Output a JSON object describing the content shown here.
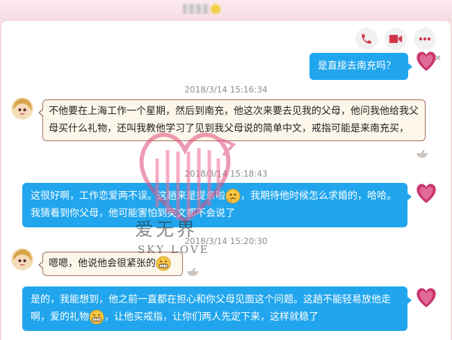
{
  "header": {
    "contact_name_blurred": true
  },
  "actions": [
    {
      "name": "phone-call",
      "icon": "phone-icon"
    },
    {
      "name": "video-call",
      "icon": "video-camera-icon"
    },
    {
      "name": "more",
      "icon": "more-dots-icon"
    }
  ],
  "colors": {
    "accent": "#d0364a",
    "bubble_out": "#21a6ee",
    "bubble_in": "#fdf6ea",
    "bubble_in_border": "#a06a5a"
  },
  "messages": {
    "m1": {
      "direction": "out",
      "text": "是直接去南充吗？"
    },
    "t1": "2018/3/14 15:16:34",
    "m2": {
      "direction": "in",
      "text": "不他要在上海工作一个星期，然后到南充，他这次来要去见我的父母，他问我他给我父母买什么礼物，还叫我教他学习了见到我父母说的简单中文，戒指可能是来南充买，"
    },
    "t2": "2018/3/14 15:18:43",
    "m3": {
      "direction": "out",
      "text_a": "这很好啊，工作恋爱两不误。这趟来是提亲啦",
      "text_b": "，我期待他时候怎么求婚的，哈哈。我猜看到你父母，他可能害怕到英文都不会说了",
      "emoji": "thinking-emoji"
    },
    "t3": "2018/3/14 15:20:30",
    "m4": {
      "direction": "in",
      "text": "嗯嗯，他说他会很紧张的",
      "emoji": "grin-emoji"
    },
    "m5": {
      "direction": "out",
      "text_a": "是的，我能想到，他之前一直都在担心和你父母见面这个问题。这趟不能轻易放他走啊，爱的礼物",
      "text_b": "，让他买戒指，让你们两人先定下来，这样就稳了",
      "emoji": "grin-emoji"
    }
  },
  "watermark": {
    "line1": "爱无界",
    "line2": "SKY LOVE"
  }
}
